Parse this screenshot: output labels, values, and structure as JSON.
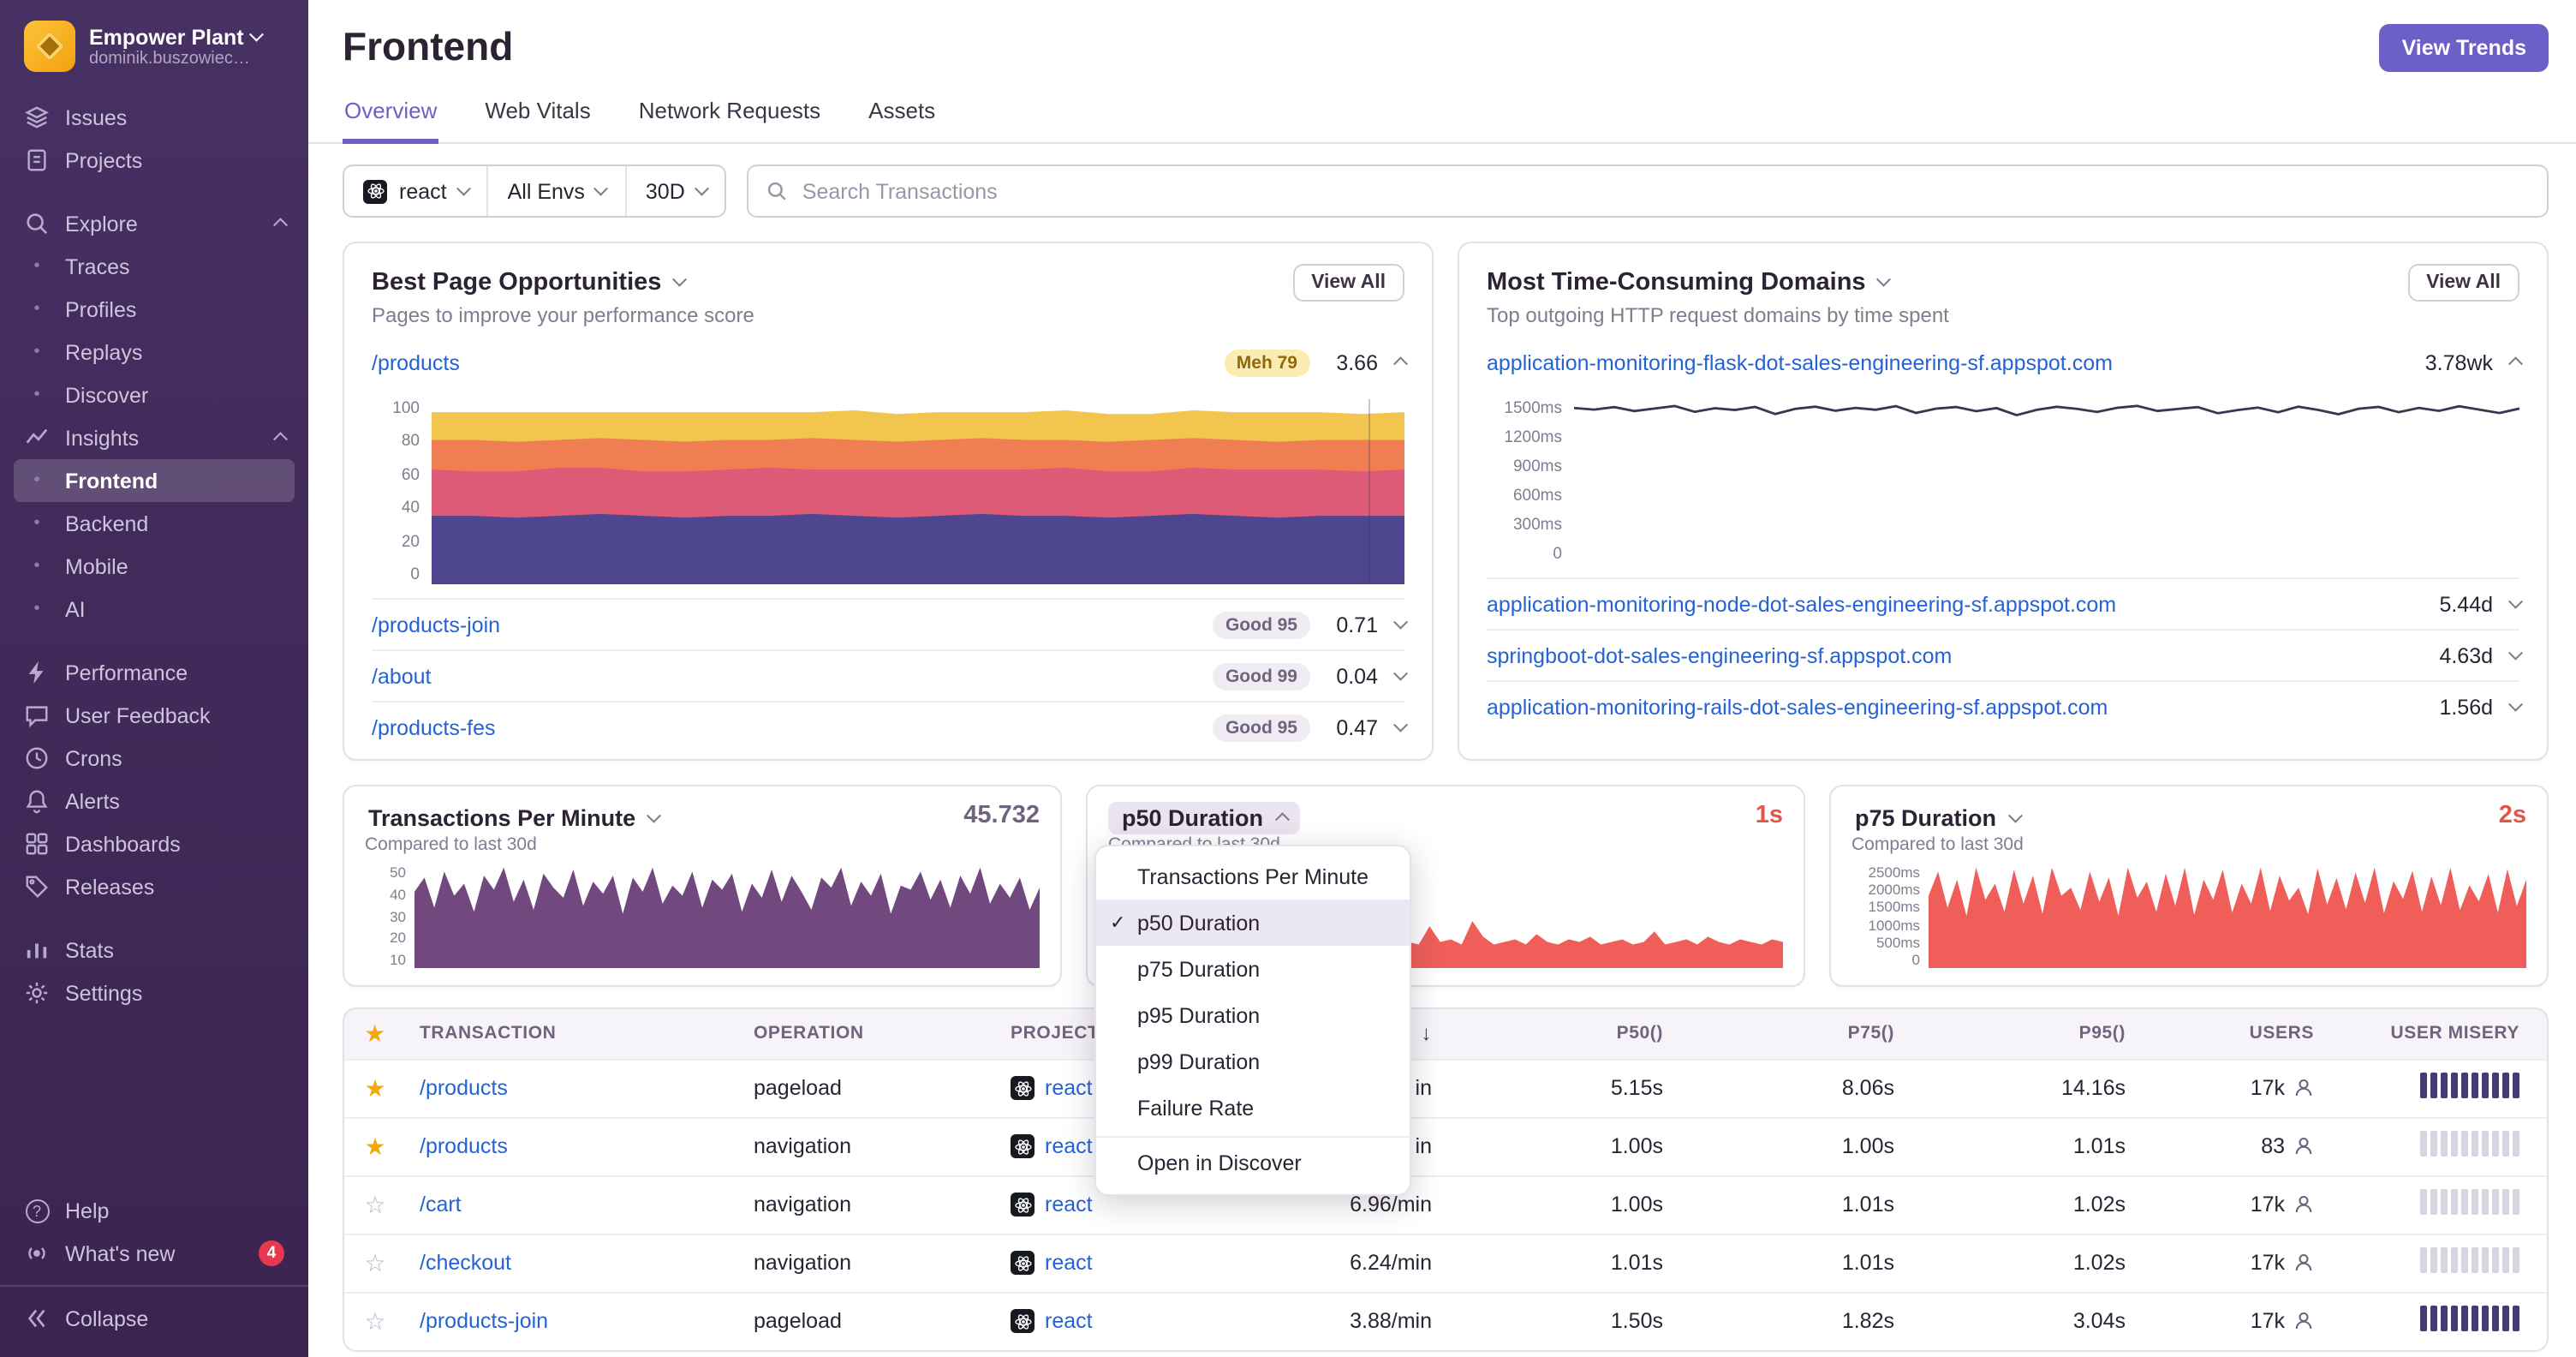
{
  "colors": {
    "accent": "#6c5fc7",
    "link": "#2562d4",
    "red_value": "#e0564b",
    "star_gold": "#f2a90c",
    "sidebar_bg": "#42265b",
    "misery_high": "#453a75",
    "misery_low": "#d8d4e2"
  },
  "sidebar": {
    "org_name": "Empower Plant",
    "org_user": "dominik.buszowiec…",
    "items_top": [
      {
        "label": "Issues"
      },
      {
        "label": "Projects"
      }
    ],
    "explore": {
      "label": "Explore",
      "children": [
        "Traces",
        "Profiles",
        "Replays",
        "Discover"
      ]
    },
    "insights": {
      "label": "Insights",
      "children": [
        "Frontend",
        "Backend",
        "Mobile",
        "AI"
      ],
      "active_child": "Frontend"
    },
    "items_mid": [
      "Performance",
      "User Feedback",
      "Crons",
      "Alerts",
      "Dashboards",
      "Releases"
    ],
    "items_low": [
      "Stats",
      "Settings"
    ],
    "footer": [
      {
        "label": "Help"
      },
      {
        "label": "What's new",
        "badge": "4"
      }
    ],
    "collapse_label": "Collapse"
  },
  "header": {
    "title": "Frontend",
    "view_trends": "View Trends",
    "tabs": [
      "Overview",
      "Web Vitals",
      "Network Requests",
      "Assets"
    ],
    "active_tab": "Overview"
  },
  "filters": {
    "project": "react",
    "env": "All Envs",
    "period": "30D",
    "search_placeholder": "Search Transactions"
  },
  "best_pages": {
    "title": "Best Page Opportunities",
    "subtitle": "Pages to improve your performance score",
    "view_all": "View All",
    "yticks": [
      "100",
      "80",
      "60",
      "40",
      "20",
      "0"
    ],
    "rows": [
      {
        "page": "/products",
        "badge": "Meh 79",
        "badge_type": "meh",
        "score": "3.66",
        "expanded": true
      },
      {
        "page": "/products-join",
        "badge": "Good 95",
        "badge_type": "good",
        "score": "0.71"
      },
      {
        "page": "/about",
        "badge": "Good 99",
        "badge_type": "good",
        "score": "0.04"
      },
      {
        "page": "/products-fes",
        "badge": "Good 95",
        "badge_type": "good",
        "score": "0.47"
      }
    ]
  },
  "domains": {
    "title": "Most Time-Consuming Domains",
    "subtitle": "Top outgoing HTTP request domains by time spent",
    "view_all": "View All",
    "yticks": [
      "1500ms",
      "1200ms",
      "900ms",
      "600ms",
      "300ms",
      "0"
    ],
    "rows": [
      {
        "domain": "application-monitoring-flask-dot-sales-engineering-sf.appspot.com",
        "value": "3.78wk",
        "expanded": true
      },
      {
        "domain": "application-monitoring-node-dot-sales-engineering-sf.appspot.com",
        "value": "5.44d"
      },
      {
        "domain": "springboot-dot-sales-engineering-sf.appspot.com",
        "value": "4.63d"
      },
      {
        "domain": "application-monitoring-rails-dot-sales-engineering-sf.appspot.com",
        "value": "1.56d"
      }
    ]
  },
  "metric_cards": {
    "tpm": {
      "title": "Transactions Per Minute",
      "value": "45.732",
      "subtitle": "Compared to last 30d",
      "yticks": [
        "50",
        "40",
        "30",
        "20",
        "10"
      ]
    },
    "p50": {
      "title": "p50 Duration",
      "value": "1s",
      "subtitle": "Compared to last 30d"
    },
    "p75": {
      "title": "p75 Duration",
      "value": "2s",
      "subtitle": "Compared to last 30d",
      "yticks": [
        "2500ms",
        "2000ms",
        "1500ms",
        "1000ms",
        "500ms",
        "0"
      ]
    }
  },
  "dropdown": {
    "items": [
      {
        "label": "Transactions Per Minute",
        "checked": false
      },
      {
        "label": "p50 Duration",
        "checked": true
      },
      {
        "label": "p75 Duration",
        "checked": false
      },
      {
        "label": "p95 Duration",
        "checked": false
      },
      {
        "label": "p99 Duration",
        "checked": false
      },
      {
        "label": "Failure Rate",
        "checked": false
      },
      {
        "label": "Open in Discover",
        "checked": false
      }
    ]
  },
  "table": {
    "headers": {
      "transaction": "TRANSACTION",
      "operation": "OPERATION",
      "project": "PROJECT",
      "tpm": "",
      "sort": "↓",
      "p50": "P50()",
      "p75": "P75()",
      "p95": "P95()",
      "users": "USERS",
      "misery": "USER MISERY"
    },
    "rows": [
      {
        "starred": true,
        "transaction": "/products",
        "operation": "pageload",
        "project": "react",
        "tpm": "in",
        "p50": "5.15s",
        "p75": "8.06s",
        "p95": "14.16s",
        "users": "17k",
        "misery": "high"
      },
      {
        "starred": true,
        "transaction": "/products",
        "operation": "navigation",
        "project": "react",
        "tpm": "in",
        "p50": "1.00s",
        "p75": "1.00s",
        "p95": "1.01s",
        "users": "83",
        "misery": "low"
      },
      {
        "starred": false,
        "transaction": "/cart",
        "operation": "navigation",
        "project": "react",
        "tpm": "6.96/min",
        "p50": "1.00s",
        "p75": "1.01s",
        "p95": "1.02s",
        "users": "17k",
        "misery": "low"
      },
      {
        "starred": false,
        "transaction": "/checkout",
        "operation": "navigation",
        "project": "react",
        "tpm": "6.24/min",
        "p50": "1.01s",
        "p75": "1.01s",
        "p95": "1.02s",
        "users": "17k",
        "misery": "low"
      },
      {
        "starred": false,
        "transaction": "/products-join",
        "operation": "pageload",
        "project": "react",
        "tpm": "3.88/min",
        "p50": "1.50s",
        "p75": "1.82s",
        "p95": "3.04s",
        "users": "17k",
        "misery": "high"
      }
    ]
  },
  "charts": {
    "score": {
      "type": "stacked",
      "ymax": 100,
      "series": [
        {
          "name": "band-1",
          "color": "#4f4690",
          "values": [
            37,
            37,
            36,
            37,
            38,
            37,
            36,
            37,
            37,
            38,
            37,
            36,
            37,
            38,
            37,
            37,
            36,
            37,
            38,
            37,
            36,
            37,
            37,
            37
          ]
        },
        {
          "name": "band-2",
          "color": "#de5b77",
          "values": [
            25,
            24,
            25,
            26,
            25,
            24,
            25,
            25,
            26,
            24,
            25,
            26,
            25,
            24,
            25,
            26,
            25,
            24,
            25,
            25,
            26,
            25,
            24,
            25
          ]
        },
        {
          "name": "band-3",
          "color": "#ef7e53",
          "values": [
            16,
            17,
            16,
            15,
            16,
            17,
            16,
            16,
            15,
            17,
            16,
            15,
            16,
            17,
            16,
            15,
            16,
            17,
            16,
            16,
            15,
            16,
            17,
            16
          ]
        },
        {
          "name": "band-4",
          "color": "#f2c64e",
          "values": [
            15,
            15,
            16,
            15,
            14,
            15,
            16,
            15,
            15,
            14,
            16,
            15,
            15,
            14,
            15,
            16,
            15,
            14,
            15,
            15,
            16,
            15,
            14,
            15
          ]
        }
      ]
    },
    "domains": {
      "type": "line",
      "ymax": 1500,
      "color": "#3d3451",
      "values": [
        1420,
        1405,
        1428,
        1392,
        1415,
        1438,
        1385,
        1418,
        1402,
        1430,
        1365,
        1412,
        1432,
        1395,
        1421,
        1404,
        1437,
        1375,
        1414,
        1429,
        1391,
        1419,
        1355,
        1403,
        1431,
        1412,
        1384,
        1422,
        1439,
        1393,
        1411,
        1428,
        1372,
        1401,
        1424,
        1381,
        1432,
        1402,
        1363,
        1413,
        1430,
        1382,
        1421,
        1394,
        1436,
        1405,
        1374,
        1415
      ]
    },
    "tpm": {
      "type": "area",
      "ymax": 52,
      "color": "#71497e",
      "values": [
        38,
        45,
        30,
        48,
        36,
        42,
        28,
        46,
        39,
        50,
        33,
        44,
        29,
        47,
        40,
        35,
        49,
        31,
        43,
        37,
        46,
        27,
        45,
        38,
        50,
        32,
        41,
        36,
        48,
        30,
        44,
        39,
        47,
        28,
        42,
        35,
        49,
        33,
        46,
        38,
        29,
        45,
        40,
        50,
        31,
        43,
        36,
        47,
        27,
        41,
        39,
        48,
        34,
        44,
        30,
        46,
        37,
        50,
        32,
        42,
        35,
        45,
        29,
        40
      ]
    },
    "p50": {
      "type": "area",
      "ymax": 4,
      "color": "#f05e59",
      "values": [
        1.0,
        0.9,
        1.1,
        1.0,
        0.9,
        1.1,
        1.0,
        1.2,
        0.9,
        1.0,
        1.1,
        0.9,
        1.0,
        1.1,
        1.0,
        0.9,
        1.4,
        2.2,
        3.4,
        1.8,
        2.9,
        3.6,
        1.5,
        2.4,
        1.2,
        1.0,
        0.9,
        1.1,
        1.0,
        0.9,
        1.6,
        1.0,
        1.1,
        0.9,
        1.8,
        1.2,
        0.9,
        1.0,
        1.1,
        0.9,
        1.3,
        1.0,
        0.9,
        1.1,
        1.0,
        1.2,
        0.9,
        1.0,
        1.1,
        0.9,
        1.0,
        1.4,
        0.9,
        1.0,
        1.1,
        0.9,
        1.2,
        1.0,
        0.9,
        1.1,
        1.0,
        0.9,
        1.1,
        1.0
      ]
    },
    "p75": {
      "type": "area",
      "ymax": 2600,
      "color": "#f05e59",
      "values": [
        1800,
        2400,
        1500,
        2200,
        1300,
        2500,
        1700,
        2100,
        1400,
        2450,
        1600,
        2300,
        1350,
        2500,
        1800,
        2000,
        1450,
        2400,
        1650,
        2250,
        1300,
        2500,
        1750,
        2150,
        1400,
        2350,
        1550,
        2500,
        1320,
        2200,
        1700,
        2450,
        1380,
        2100,
        1600,
        2500,
        1420,
        2300,
        1680,
        2000,
        1340,
        2480,
        1580,
        2240,
        1460,
        2380,
        1620,
        2500,
        1360,
        2160,
        1720,
        2420,
        1400,
        2280,
        1560,
        2500,
        1440,
        2060,
        1660,
        2340,
        1380,
        2460,
        1540,
        2200
      ]
    }
  }
}
